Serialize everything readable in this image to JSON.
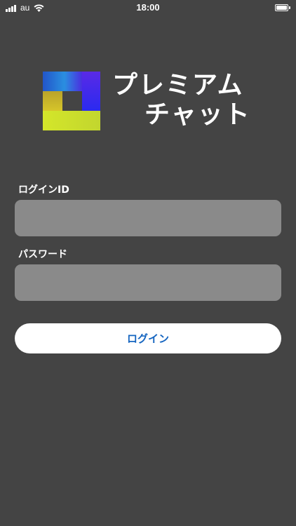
{
  "status_bar": {
    "carrier": "au",
    "time": "18:00"
  },
  "logo": {
    "line1": "プレミアム",
    "line2": "チャット"
  },
  "form": {
    "login_id_label": "ログインID",
    "login_id_value": "",
    "password_label": "パスワード",
    "password_value": "",
    "login_button_label": "ログイン"
  },
  "colors": {
    "background": "#444444",
    "input_background": "#8a8a8a",
    "button_text": "#1565c0"
  }
}
